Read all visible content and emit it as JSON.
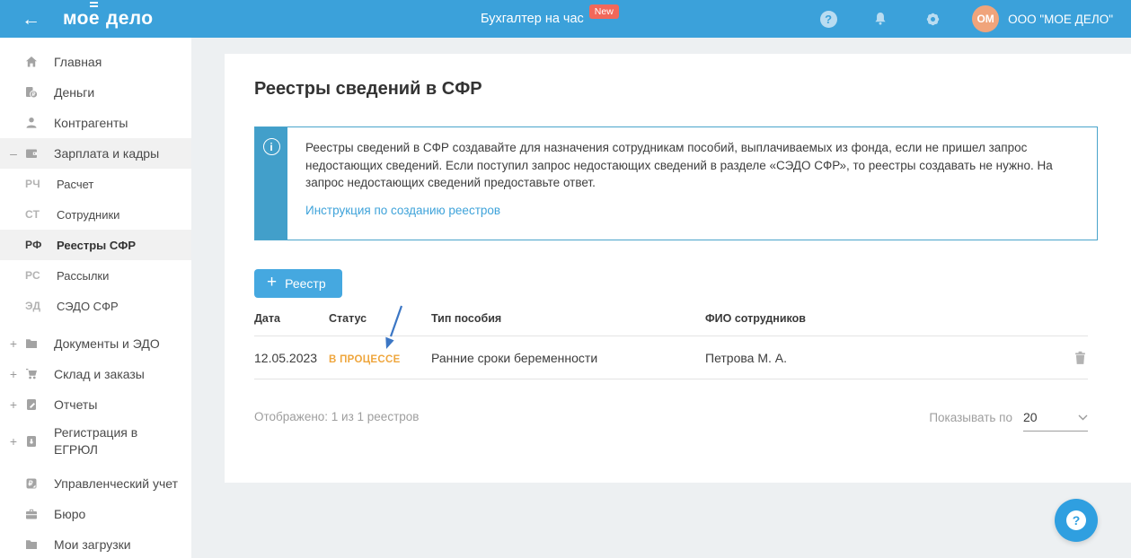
{
  "header": {
    "back_glyph": "←",
    "logo": {
      "part1": "мо",
      "accented_letter": "е",
      "part2": "дело"
    },
    "promo": {
      "label": "Бухгалтер на час",
      "badge": "New"
    },
    "help_glyph": "?",
    "account": {
      "avatar_initials": "ОМ",
      "company_name": "ООО \"МОЕ ДЕЛО\""
    }
  },
  "sidebar": {
    "items": [
      {
        "label": "Главная",
        "expand": ""
      },
      {
        "label": "Деньги",
        "expand": ""
      },
      {
        "label": "Контрагенты",
        "expand": ""
      },
      {
        "label": "Зарплата и кадры",
        "expand": "–"
      },
      {
        "label": "Расчет",
        "prefix": "РЧ"
      },
      {
        "label": "Сотрудники",
        "prefix": "СТ"
      },
      {
        "label": "Реестры СФР",
        "prefix": "РФ"
      },
      {
        "label": "Рассылки",
        "prefix": "РС"
      },
      {
        "label": "СЭДО СФР",
        "prefix": "ЭД"
      },
      {
        "label": "Документы и ЭДО",
        "expand": "+"
      },
      {
        "label": "Склад и заказы",
        "expand": "+"
      },
      {
        "label": "Отчеты",
        "expand": "+"
      },
      {
        "label": "Регистрация в ЕГРЮЛ",
        "expand": "+"
      },
      {
        "label": "Управленческий учет",
        "expand": ""
      },
      {
        "label": "Бюро",
        "expand": ""
      },
      {
        "label": "Мои загрузки",
        "expand": ""
      }
    ]
  },
  "main": {
    "title": "Реестры сведений в СФР",
    "info_box": {
      "icon_glyph": "i",
      "text": "Реестры сведений в СФР создавайте для назначения сотрудникам пособий, выплачиваемых из фонда, если не пришел запрос недостающих сведений. Если поступил запрос недостающих сведений в разделе «СЭДО СФР», то реестры создавать не нужно. На запрос недостающих сведений предоставьте ответ.",
      "link": "Инструкция по созданию реестров"
    },
    "add_button": {
      "plus": "+",
      "label": "Реестр"
    },
    "table": {
      "headers": [
        "Дата",
        "Статус",
        "Тип пособия",
        "ФИО сотрудников"
      ],
      "rows": [
        {
          "date": "12.05.2023",
          "status": "В ПРОЦЕССЕ",
          "benefit_type": "Ранние сроки беременности",
          "employees": "Петрова М. А."
        }
      ]
    },
    "footer": {
      "shown_text": "Отображено: 1 из 1 реестров",
      "per_page_label": "Показывать по",
      "per_page_value": "20"
    },
    "fab_glyph": "?"
  },
  "colors": {
    "header_blue": "#3ba1da",
    "badge_red": "#f2685a",
    "avatar_orange": "#f0a47b",
    "accent_blue": "#45a8e0",
    "info_border_blue": "#4aa4cb",
    "link_blue": "#3fa3da",
    "status_orange": "#efa63d",
    "annotation_arrow_blue": "#3b76c4",
    "content_bg": "#edf0f2"
  }
}
